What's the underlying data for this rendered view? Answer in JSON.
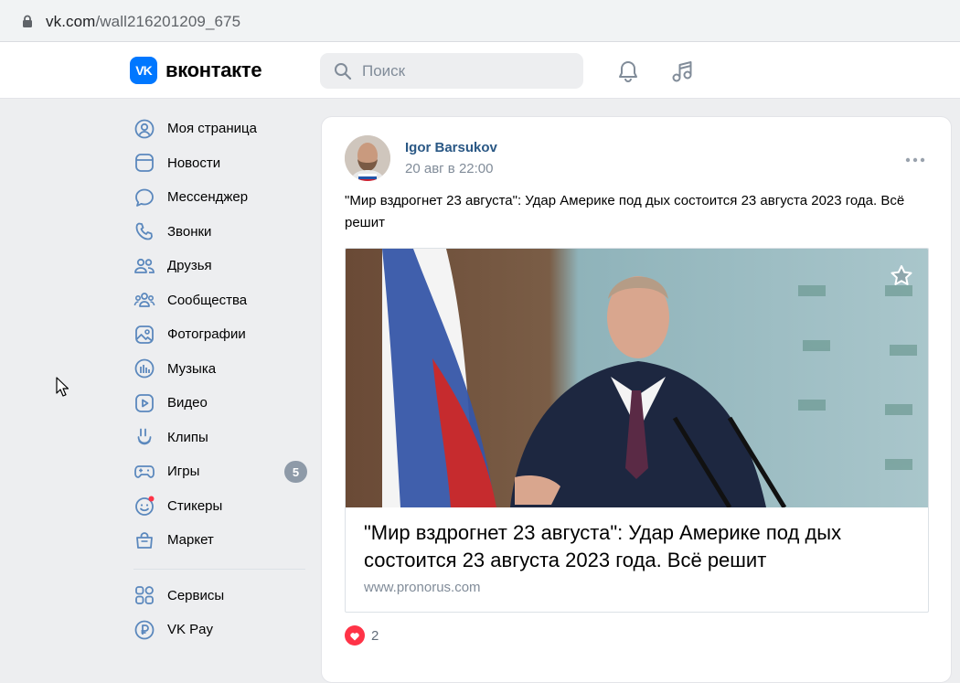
{
  "browser": {
    "url_host": "vk.com",
    "url_path": "/wall216201209_675"
  },
  "header": {
    "logo_mark": "VK",
    "logo_text": "вконтакте",
    "search_placeholder": "Поиск"
  },
  "sidebar": {
    "items": [
      {
        "label": "Моя страница",
        "icon": "user-circle-icon"
      },
      {
        "label": "Новости",
        "icon": "news-icon"
      },
      {
        "label": "Мессенджер",
        "icon": "message-icon"
      },
      {
        "label": "Звонки",
        "icon": "phone-icon"
      },
      {
        "label": "Друзья",
        "icon": "friends-icon"
      },
      {
        "label": "Сообщества",
        "icon": "communities-icon"
      },
      {
        "label": "Фотографии",
        "icon": "photo-icon"
      },
      {
        "label": "Музыка",
        "icon": "music-icon"
      },
      {
        "label": "Видео",
        "icon": "video-icon"
      },
      {
        "label": "Клипы",
        "icon": "clips-icon"
      },
      {
        "label": "Игры",
        "icon": "gamepad-icon",
        "badge": "5"
      },
      {
        "label": "Стикеры",
        "icon": "sticker-icon"
      },
      {
        "label": "Маркет",
        "icon": "market-icon"
      }
    ],
    "secondary": [
      {
        "label": "Сервисы",
        "icon": "services-icon"
      },
      {
        "label": "VK Pay",
        "icon": "vkpay-icon"
      }
    ]
  },
  "post": {
    "author": "Igor Barsukov",
    "date": "20 авг в 22:00",
    "text": "\"Мир вздрогнет 23 августа\": Удар Америке под дых состоится 23 августа 2023 года. Всё решит",
    "attachment": {
      "title": "\"Мир вздрогнет 23 августа\": Удар Америке под дых состоится 23 августа 2023 года. Всё решит",
      "domain": "www.pronorus.com"
    },
    "likes": "2"
  },
  "colors": {
    "brand": "#0077ff",
    "link": "#2a5885",
    "background": "#edeef0",
    "like": "#ff3347",
    "icon": "#5b88bd"
  }
}
